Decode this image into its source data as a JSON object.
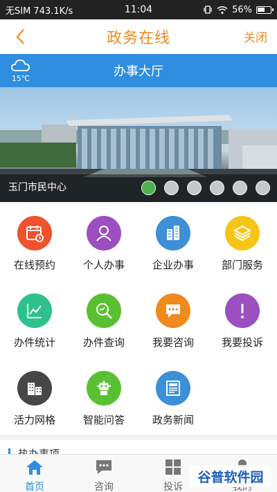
{
  "status_bar": {
    "carrier": "无SIM 743.1K/s",
    "time": "11:04",
    "battery": "56%"
  },
  "nav": {
    "title": "政务在线",
    "close_label": "关闭"
  },
  "hall": {
    "title": "办事大厅",
    "temperature": "15℃"
  },
  "banner": {
    "caption": "玉门市民中心",
    "slide_count": 6,
    "active_slide": 1
  },
  "grid": [
    {
      "label": "在线预约",
      "icon": "calendar-clock-icon",
      "color": "#f0522e"
    },
    {
      "label": "个人办事",
      "icon": "person-icon",
      "color": "#9b4fc0"
    },
    {
      "label": "企业办事",
      "icon": "building-icon",
      "color": "#3d8fd6"
    },
    {
      "label": "部门服务",
      "icon": "layers-icon",
      "color": "#f5c517"
    },
    {
      "label": "办件统计",
      "icon": "line-chart-icon",
      "color": "#2ec18b"
    },
    {
      "label": "办件查询",
      "icon": "magnifier-icon",
      "color": "#58c031"
    },
    {
      "label": "我要咨询",
      "icon": "chat-bubble-icon",
      "color": "#f08a1c"
    },
    {
      "label": "我要投诉",
      "icon": "exclamation-icon",
      "color": "#9b4fc0"
    },
    {
      "label": "活力网格",
      "icon": "city-icon",
      "color": "#474747"
    },
    {
      "label": "智能问答",
      "icon": "robot-icon",
      "color": "#58c031"
    },
    {
      "label": "政务新闻",
      "icon": "newspaper-icon",
      "color": "#3d8fd6"
    }
  ],
  "section": {
    "title": "热办事项"
  },
  "tabs": [
    {
      "label": "首页",
      "icon": "home-icon",
      "active": true
    },
    {
      "label": "咨询",
      "icon": "chat-icon",
      "active": false
    },
    {
      "label": "投诉",
      "icon": "grid-icon",
      "active": false
    },
    {
      "label": "我的",
      "icon": "user-icon",
      "active": false
    }
  ],
  "watermark": "谷普软件园"
}
